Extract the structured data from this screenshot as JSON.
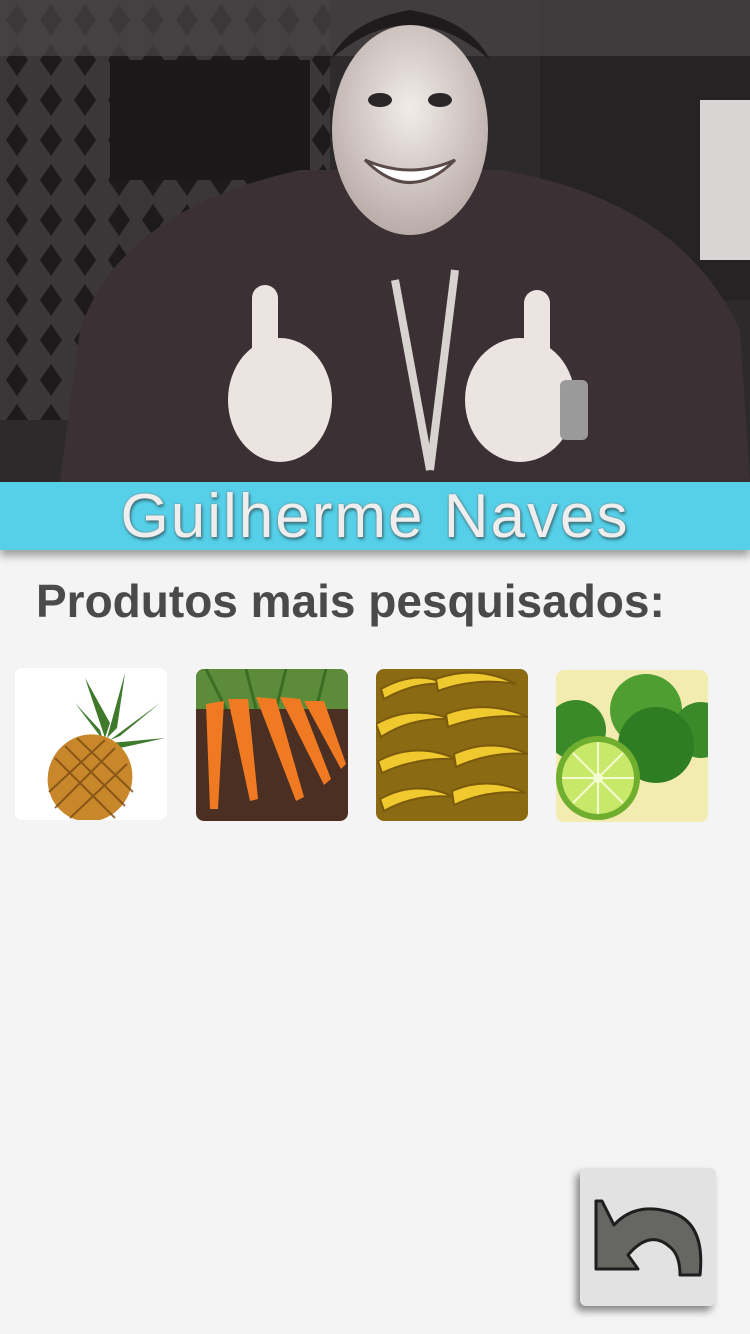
{
  "profile": {
    "name": "Guilherme Naves"
  },
  "section": {
    "title": "Produtos mais pesquisados:"
  },
  "products": [
    {
      "icon": "pineapple-icon"
    },
    {
      "icon": "carrot-icon"
    },
    {
      "icon": "banana-icon"
    },
    {
      "icon": "lime-icon"
    }
  ],
  "actions": {
    "back_icon": "back-arrow-icon"
  },
  "colors": {
    "banner": "#55d0e8",
    "title_text": "#4a4a4a",
    "background": "#f4f4f4"
  }
}
